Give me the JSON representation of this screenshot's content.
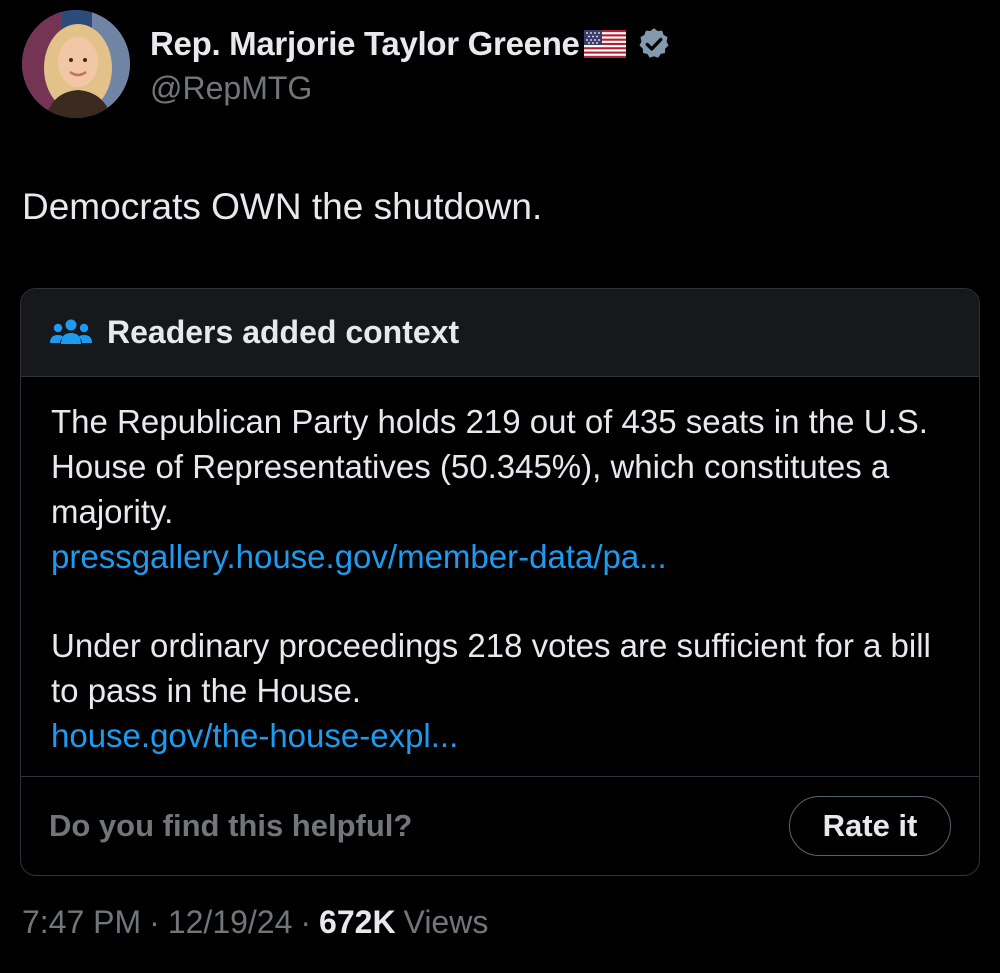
{
  "author": {
    "display_name": "Rep. Marjorie Taylor Greene",
    "handle": "@RepMTG",
    "flag_icon": "us-flag-emoji",
    "verified_icon": "verified-badge-icon",
    "verified_color": "#829aab"
  },
  "tweet": {
    "text": "Democrats OWN the shutdown."
  },
  "community_note": {
    "icon": "people-icon",
    "icon_color": "#1d9bf0",
    "title": "Readers added context",
    "paragraph_1": "The Republican Party holds 219 out of 435 seats in the U.S. House of Representatives (50.345%), which constitutes a majority.",
    "link_1": "pressgallery.house.gov/member-data/pa...",
    "paragraph_2": "Under ordinary proceedings 218 votes are sufficient for a bill to pass in the House.",
    "link_2": "house.gov/the-house-expl...",
    "link_color": "#1d9bf0",
    "helpful_question": "Do you find this helpful?",
    "rate_button_label": "Rate it"
  },
  "meta": {
    "time": "7:47 PM",
    "separator": "·",
    "date": "12/19/24",
    "views_count": "672K",
    "views_label": "Views"
  }
}
